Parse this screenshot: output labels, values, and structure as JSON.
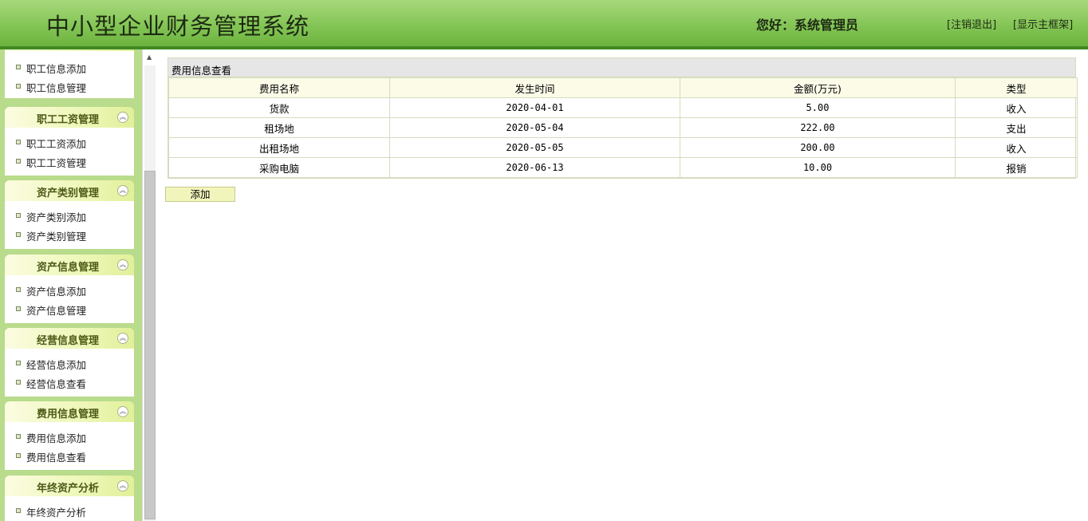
{
  "header": {
    "title": "中小型企业财务管理系统",
    "greeting": "您好：系统管理员",
    "logout_link": "[注销退出]",
    "show_frame_link": "[显示主框架]"
  },
  "sidebar": {
    "groups": [
      {
        "title": "",
        "items": [
          "职工信息添加",
          "职工信息管理"
        ]
      },
      {
        "title": "职工工资管理",
        "items": [
          "职工工资添加",
          "职工工资管理"
        ]
      },
      {
        "title": "资产类别管理",
        "items": [
          "资产类别添加",
          "资产类别管理"
        ]
      },
      {
        "title": "资产信息管理",
        "items": [
          "资产信息添加",
          "资产信息管理"
        ]
      },
      {
        "title": "经营信息管理",
        "items": [
          "经营信息添加",
          "经营信息查看"
        ]
      },
      {
        "title": "费用信息管理",
        "items": [
          "费用信息添加",
          "费用信息查看"
        ]
      },
      {
        "title": "年终资产分析",
        "items": [
          "年终资产分析"
        ]
      }
    ],
    "collapse_icon": "double-chevron-up-icon"
  },
  "main": {
    "panel_title": "费用信息查看",
    "columns": [
      "费用名称",
      "发生时间",
      "金额(万元)",
      "类型"
    ],
    "rows": [
      [
        "货款",
        "2020-04-01",
        "5.00",
        "收入"
      ],
      [
        "租场地",
        "2020-05-04",
        "222.00",
        "支出"
      ],
      [
        "出租场地",
        "2020-05-05",
        "200.00",
        "收入"
      ],
      [
        "采购电脑",
        "2020-06-13",
        "10.00",
        "报销"
      ]
    ],
    "add_button": "添加"
  },
  "colors": {
    "header_green": "#84c556",
    "sidebar_green": "#b9db8c",
    "menu_title": "#4c5a16"
  }
}
